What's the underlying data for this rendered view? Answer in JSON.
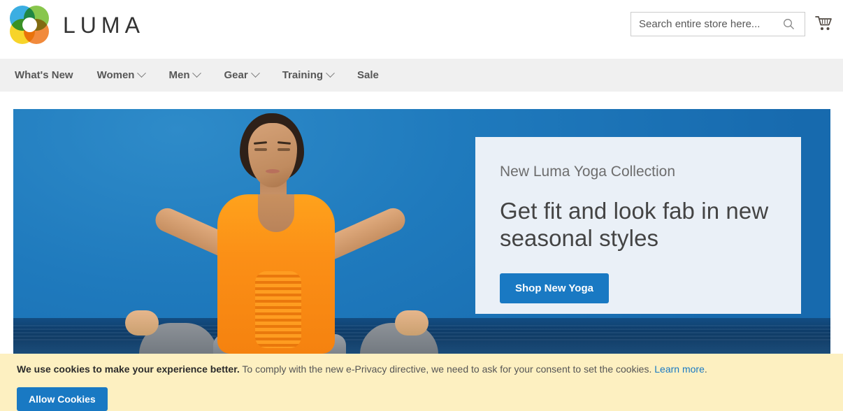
{
  "header": {
    "brand": "LUMA",
    "logo_icon": "luma-flower-logo",
    "search": {
      "placeholder": "Search entire store here...",
      "value": "",
      "icon": "search-icon"
    },
    "cart": {
      "icon": "shopping-cart-icon"
    }
  },
  "nav": {
    "items": [
      {
        "label": "What's New",
        "has_dropdown": false
      },
      {
        "label": "Women",
        "has_dropdown": true
      },
      {
        "label": "Men",
        "has_dropdown": true
      },
      {
        "label": "Gear",
        "has_dropdown": true
      },
      {
        "label": "Training",
        "has_dropdown": true
      },
      {
        "label": "Sale",
        "has_dropdown": false
      }
    ]
  },
  "hero": {
    "eyebrow": "New Luma Yoga Collection",
    "title": "Get fit and look fab in new seasonal styles",
    "cta_label": "Shop New Yoga",
    "panel_bg": "#eaf0f7",
    "accent": "#1979c3",
    "image_alt": "woman-meditating-lotus-pose-ocean"
  },
  "cookie_banner": {
    "bold_text": "We use cookies to make your experience better.",
    "normal_text": " To comply with the new e-Privacy directive, we need to ask for your consent to set the cookies.",
    "link_text": "Learn more",
    "link_suffix": ".",
    "button_label": "Allow Cookies",
    "background": "#fdf0c1"
  }
}
